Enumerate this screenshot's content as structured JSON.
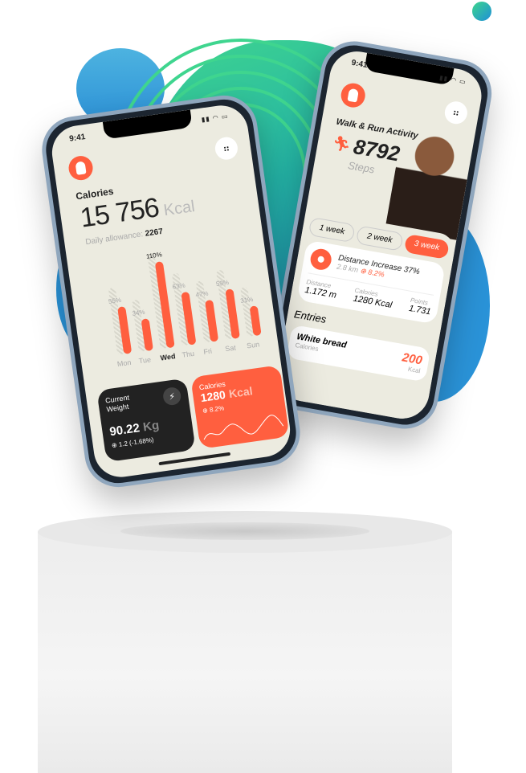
{
  "left_phone": {
    "time": "9:41",
    "calories_label": "Calories",
    "calories_value": "15 756",
    "calories_unit": "Kcal",
    "allowance_label": "Daily allowance:",
    "allowance_value": "2267",
    "chart_data": {
      "type": "bar",
      "categories": [
        "Mon",
        "Tue",
        "Wed",
        "Thu",
        "Fri",
        "Sat",
        "Sun"
      ],
      "values": [
        55,
        34,
        110,
        63,
        47,
        59,
        31
      ],
      "labels": [
        "55%",
        "34%",
        "110%",
        "63%",
        "47%",
        "59%",
        "31%"
      ],
      "highlight": "Wed"
    },
    "weight_card": {
      "title": "Current Weight",
      "value": "90.22",
      "unit": "Kg",
      "change": "1.2 (-1.68%)"
    },
    "calories_card": {
      "title": "Calories",
      "value": "1280",
      "unit": "Kcal",
      "change": "8.2%"
    }
  },
  "right_phone": {
    "time": "9:41",
    "title": "Walk & Run Activity",
    "steps_value": "8792",
    "steps_label": "Steps",
    "tabs": [
      {
        "label": "1 week"
      },
      {
        "label": "2 week"
      },
      {
        "label": "3 week",
        "active": true
      }
    ],
    "distance_card": {
      "title": "Distance Increase 37%",
      "km": "2.8 km",
      "change": "8.2%"
    },
    "stats": [
      {
        "label": "Distance",
        "value": "1.172 m"
      },
      {
        "label": "Calories",
        "value": "1280 Kcal"
      },
      {
        "label": "Points",
        "value": "1.731"
      }
    ],
    "entries_title": "Entries",
    "entry": {
      "name": "White bread",
      "sub": "Calories",
      "value": "200",
      "unit": "Kcal"
    }
  },
  "colors": {
    "accent": "#ff5f3f",
    "dark": "#222222",
    "screen": "#ecebe0"
  }
}
